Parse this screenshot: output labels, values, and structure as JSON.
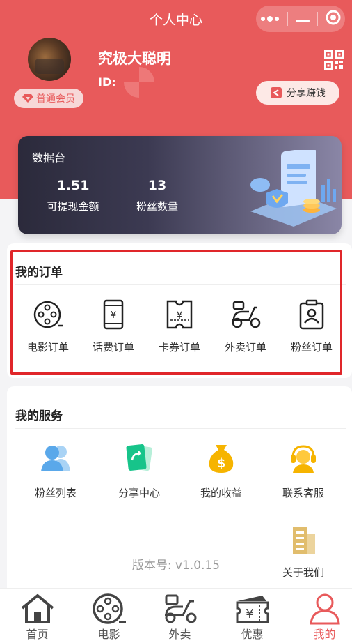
{
  "header": {
    "title": "个人中心",
    "nickname": "究极大聪明",
    "id_label": "ID:",
    "member_badge": "普通会员",
    "share_earn": "分享赚钱",
    "bg_color": "#e85a5b"
  },
  "dashboard": {
    "title": "数据台",
    "stats": [
      {
        "value": "1.51",
        "label": "可提现金额"
      },
      {
        "value": "13",
        "label": "粉丝数量"
      }
    ]
  },
  "orders": {
    "title": "我的订单",
    "items": [
      {
        "label": "电影订单",
        "icon": "film-reel-icon"
      },
      {
        "label": "话费订单",
        "icon": "phone-yen-icon"
      },
      {
        "label": "卡券订单",
        "icon": "coupon-ticket-icon"
      },
      {
        "label": "外卖订单",
        "icon": "scooter-icon"
      },
      {
        "label": "粉丝订单",
        "icon": "badge-person-icon"
      }
    ]
  },
  "services": {
    "title": "我的服务",
    "items": [
      {
        "label": "粉丝列表",
        "icon": "users-icon"
      },
      {
        "label": "分享中心",
        "icon": "share-card-icon"
      },
      {
        "label": "我的收益",
        "icon": "money-bag-icon"
      },
      {
        "label": "联系客服",
        "icon": "headset-agent-icon"
      },
      {
        "label": "关于我们",
        "icon": "building-icon"
      }
    ]
  },
  "version": "版本号:  v1.0.15",
  "tabbar": {
    "items": [
      {
        "label": "首页",
        "icon": "home-icon"
      },
      {
        "label": "电影",
        "icon": "film-reel-icon"
      },
      {
        "label": "外卖",
        "icon": "scooter-icon"
      },
      {
        "label": "优惠",
        "icon": "coupon-icon"
      },
      {
        "label": "我的",
        "icon": "person-icon"
      }
    ],
    "active_color": "#e85a5b"
  }
}
